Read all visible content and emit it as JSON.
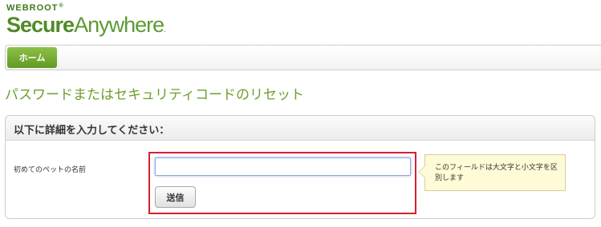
{
  "logo": {
    "brand": "WEBROOT",
    "brand_mark": "®",
    "product_bold": "Secure",
    "product_light": "Anywhere",
    "product_mark": "."
  },
  "nav": {
    "home_label": "ホーム"
  },
  "page": {
    "title": "パスワードまたはセキュリティコードのリセット"
  },
  "form": {
    "header": "以下に詳細を入力してください：",
    "field_label": "初めてのペットの名前",
    "field_value": "",
    "submit_label": "送信",
    "tooltip_text": "このフィールドは大文字と小文字を区別します"
  },
  "colors": {
    "brand_green": "#5d9a32",
    "title_green": "#6c9f2e",
    "highlight_red": "#d8202d",
    "tooltip_bg": "#fefbd6"
  }
}
